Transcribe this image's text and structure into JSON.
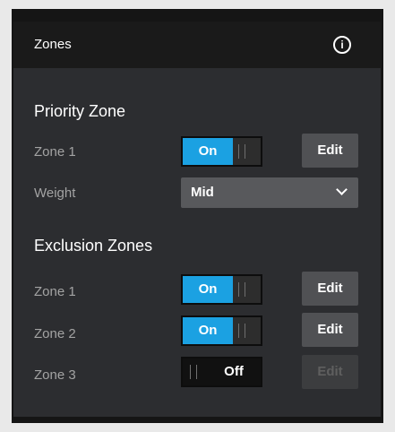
{
  "header": {
    "title": "Zones",
    "info_icon": "i"
  },
  "priority_zone": {
    "title": "Priority Zone",
    "zone1": {
      "label": "Zone 1",
      "toggle": "On",
      "edit": "Edit"
    },
    "weight": {
      "label": "Weight",
      "value": "Mid"
    }
  },
  "exclusion_zones": {
    "title": "Exclusion Zones",
    "zones": [
      {
        "label": "Zone 1",
        "toggle": "On",
        "edit": "Edit",
        "enabled": true
      },
      {
        "label": "Zone 2",
        "toggle": "On",
        "edit": "Edit",
        "enabled": true
      },
      {
        "label": "Zone 3",
        "toggle": "Off",
        "edit": "Edit",
        "enabled": false
      }
    ]
  },
  "colors": {
    "accent": "#1ba1e2",
    "panel": "#2c2d30",
    "header": "#1a1a1a"
  }
}
